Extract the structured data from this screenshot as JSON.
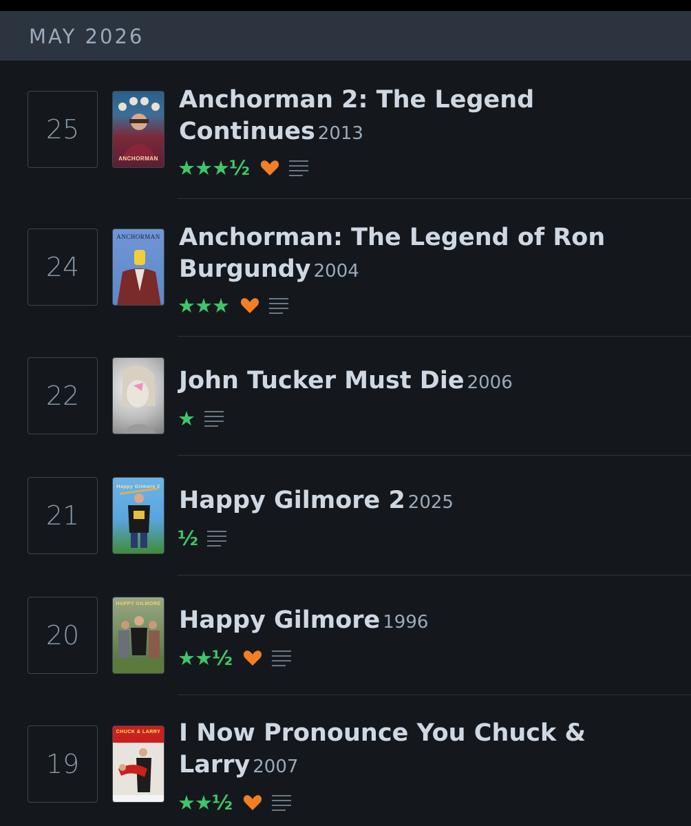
{
  "month": "MAY 2026",
  "entries": [
    {
      "day": "25",
      "title": "Anchorman 2: The Legend Continues",
      "year": "2013",
      "stars": "★★★½",
      "liked": true,
      "poster_text": "ANCHORMAN",
      "poster_colors": [
        "#5a1f33",
        "#8d2a3e",
        "#c9b98f"
      ]
    },
    {
      "day": "24",
      "title": "Anchorman: The Legend of Ron Burgundy",
      "year": "2004",
      "stars": "★★★",
      "liked": true,
      "poster_text": "ANCHORMAN",
      "poster_colors": [
        "#5e87c7",
        "#6c95d3",
        "#7a2a2a"
      ]
    },
    {
      "day": "22",
      "title": "John Tucker Must Die",
      "year": "2006",
      "stars": "★",
      "liked": false,
      "poster_text": "",
      "poster_colors": [
        "#d9d9d9",
        "#8a8a8a",
        "#f08fbf"
      ]
    },
    {
      "day": "21",
      "title": "Happy Gilmore 2",
      "year": "2025",
      "stars": "½",
      "liked": false,
      "poster_text": "Happy Gilmore 2",
      "poster_colors": [
        "#5aa4dd",
        "#2d6a9a",
        "#3f8c3a"
      ]
    },
    {
      "day": "20",
      "title": "Happy Gilmore",
      "year": "1996",
      "stars": "★★½",
      "liked": true,
      "poster_text": "HAPPY GILMORE",
      "poster_colors": [
        "#8e9a74",
        "#4e6b3c",
        "#7a6a55"
      ]
    },
    {
      "day": "19",
      "title": "I Now Pronounce You Chuck & Larry",
      "year": "2007",
      "stars": "★★½",
      "liked": true,
      "poster_text": "CHUCK & LARRY",
      "poster_colors": [
        "#c92020",
        "#e8e3dc",
        "#1d1d1d"
      ]
    }
  ],
  "colors": {
    "star": "#40c66a",
    "heart": "#f27f24",
    "icon": "#6b7885"
  }
}
